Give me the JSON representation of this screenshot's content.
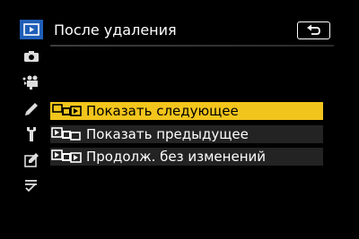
{
  "header": {
    "title": "После удаления"
  },
  "sidebar": {
    "active_item": "playback-menu",
    "items": [
      {
        "name": "playback-menu-tab",
        "icon": "playback-icon"
      },
      {
        "name": "photo-shooting-menu-tab",
        "icon": "camera-icon"
      },
      {
        "name": "movie-shooting-menu-tab",
        "icon": "movie-camera-icon"
      },
      {
        "name": "custom-settings-menu-tab",
        "icon": "pencil-icon"
      },
      {
        "name": "setup-menu-tab",
        "icon": "wrench-icon"
      },
      {
        "name": "retouch-menu-tab",
        "icon": "retouch-icon"
      },
      {
        "name": "my-menu-tab",
        "icon": "my-menu-list-icon"
      }
    ]
  },
  "menu": {
    "selected_index": 0,
    "options": [
      {
        "label": "Показать следующее",
        "icon": "show-next-icon"
      },
      {
        "label": "Показать предыдущее",
        "icon": "show-previous-icon"
      },
      {
        "label": "Продолж. без изменений",
        "icon": "continue-as-before-icon"
      }
    ]
  },
  "colors": {
    "background": "#000000",
    "active_tab": "#1f5fb8",
    "selection": "#f2c51c",
    "row": "#232323",
    "text": "#ffffff"
  }
}
